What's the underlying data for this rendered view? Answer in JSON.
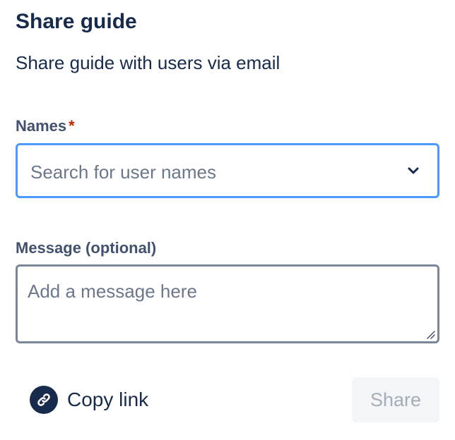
{
  "dialog": {
    "title": "Share guide",
    "subtitle": "Share guide with users via email"
  },
  "names_field": {
    "label": "Names",
    "required_marker": "*",
    "placeholder": "Search for user names",
    "icon": "chevron-down-icon"
  },
  "message_field": {
    "label": "Message (optional)",
    "placeholder": "Add a message here"
  },
  "footer": {
    "copy_link_label": "Copy link",
    "copy_link_icon": "link-icon",
    "share_label": "Share",
    "share_disabled": true
  },
  "colors": {
    "text_primary": "#172b4d",
    "label": "#42526e",
    "required": "#bf2600",
    "focus_border": "#4c9aff",
    "input_border": "#7a869a",
    "placeholder": "#6b778c",
    "disabled_bg": "#f4f5f7",
    "disabled_text": "#a5adba"
  }
}
